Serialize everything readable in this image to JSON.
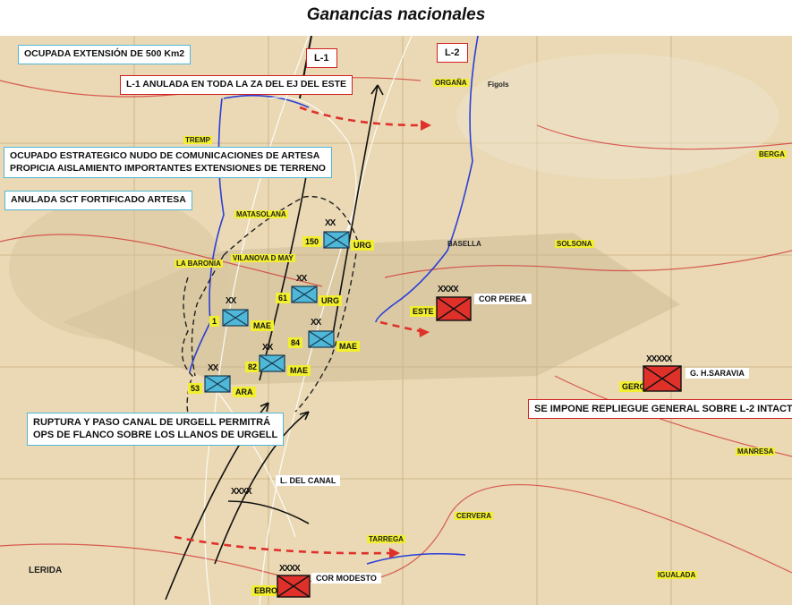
{
  "title": "Ganancias nacionales",
  "colors": {
    "map_bg": "#ead9b4",
    "friendly": "#4fb8d8",
    "enemy": "#e0302a",
    "highlight": "#f2ef2e",
    "river": "#2a3fd8",
    "road": "#d03030"
  },
  "notes": {
    "area": "OCUPADA EXTENSIÓN DE 500 Km2",
    "l1": "L-1 ANULADA EN TODA LA ZA DEL EJ DEL ESTE",
    "node_line1": "OCUPADO ESTRATEGICO NUDO DE COMUNICACIONES DE ARTESA",
    "node_line2": "PROPICIA AISLAMIENTO IMPORTANTES EXTENSIONES DE TERRENO",
    "sct": "ANULADA SCT FORTIFICADO ARTESA",
    "canal_line1": "RUPTURA Y PASO  CANAL DE URGELL PERMITRÁ",
    "canal_line2": "OPS DE FLANCO SOBRE LOS LLANOS DE URGELL",
    "repliegue": "SE IMPONE REPLIEGUE GENERAL SOBRE L-2 INTACTA"
  },
  "lines": {
    "l1": "L-1",
    "l2": "L-2",
    "canal": "L. DEL CANAL"
  },
  "friendly_units": [
    {
      "number": "150",
      "corps": "URG",
      "echelon": "XX"
    },
    {
      "number": "61",
      "corps": "URG",
      "echelon": "XX"
    },
    {
      "number": "1",
      "corps": "MAE",
      "echelon": "XX"
    },
    {
      "number": "84",
      "corps": "MAE",
      "echelon": "XX"
    },
    {
      "number": "82",
      "corps": "MAE",
      "echelon": "XX"
    },
    {
      "number": "53",
      "corps": "ARA",
      "echelon": "XX"
    }
  ],
  "enemy_units": [
    {
      "tag": "ESTE",
      "name": "COR PEREA",
      "echelon": "XXXX"
    },
    {
      "tag": "GERO",
      "name": "G. H.SARAVIA",
      "echelon": "XXXXX"
    },
    {
      "tag": "EBRO",
      "name": "COR MODESTO",
      "echelon": "XXXX"
    }
  ],
  "canal_echelon": "XXXX",
  "towns": {
    "organa": "ORGAÑA",
    "tremp": "TREMP",
    "berga": "BERGA",
    "matasolana": "MATASOLANA",
    "la_baronia": "LA BARONIA",
    "vilanova": "VILANOVA D MAY",
    "basella": "BASELLA",
    "solsona": "SOLSONA",
    "manresa": "MANRESA",
    "cervera": "CERVERA",
    "tarrega": "TARREGA",
    "lerida": "LERIDA",
    "igualada": "IGUALADA",
    "figols": "Figols"
  }
}
